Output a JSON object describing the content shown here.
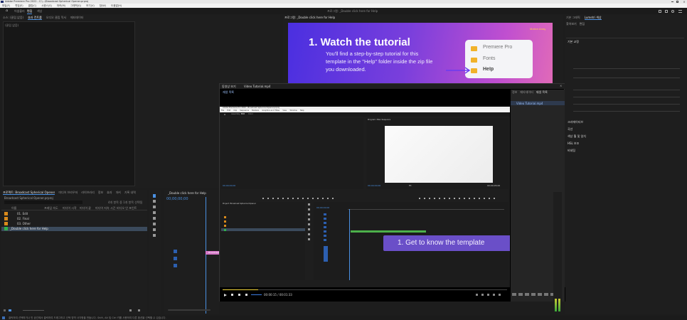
{
  "app": {
    "title_bar": "Adobe Premiere Pro 2022 - C:\\...\\Broadcast Spherical Opener.prproj",
    "menu": [
      "파일(F)",
      "편집(E)",
      "클립(C)",
      "시퀀스(S)",
      "마커(M)",
      "그래픽(G)",
      "보기(V)",
      "창(W)",
      "도움말(H)"
    ],
    "workspace_tabs": [
      "어셈블리",
      "편집",
      "색상"
    ],
    "active_workspace": "편집"
  },
  "source_panel": {
    "tabs": [
      "소스: (클립 없음)",
      "효과 컨트롤",
      "오디오 클립 믹서",
      "메타데이터"
    ],
    "empty_text": "(클립 없음)"
  },
  "program_panel": {
    "tab": "프로그램: _Double click here for Help"
  },
  "tutorial": {
    "brand": "Motion Array",
    "heading": "1.  Watch the tutorial",
    "body_line1": "You'll find a step-by-step tutorial for this",
    "body_line2": "template in the \"Help\" folder inside the zip file",
    "body_line3": "you downloaded.",
    "folders": [
      "Premiere Pro",
      "Fonts",
      "Help"
    ],
    "highlight_folder": "Help",
    "accent": "#6a3cf0"
  },
  "right_panel": {
    "tabs": [
      "기본 그래픽",
      "Lumetri 색상"
    ],
    "sub_tabs": [
      "찾아보기",
      "편집"
    ],
    "rows": [
      "기본 교정",
      "크리에이티브",
      "곡선",
      "색상 휠 및 일치",
      "HSL 보조",
      "비네팅"
    ]
  },
  "project_panel": {
    "tabs": [
      "프로젝트: Broadcast Spherical Opener",
      "미디어 브라우저",
      "라이브러리",
      "정보",
      "효과",
      "마커",
      "기록 내역"
    ],
    "file": "Broadcast Spherical Opener.prproj",
    "columns": [
      "이름",
      "프레임 속도",
      "미디어 시작",
      "미디어 끝",
      "미디어 지속 시간",
      "비디오 인 포인트"
    ],
    "items": [
      {
        "name": "01. Edit",
        "color": "#d98a1b"
      },
      {
        "name": "02. Final",
        "color": "#d98a1b"
      },
      {
        "name": "03. Other",
        "color": "#d98a1b"
      },
      {
        "name": "_Double click here for Help",
        "color": "#30b34a"
      }
    ],
    "item_count": "4개 항목 중 1개 항목 선택됨"
  },
  "timeline": {
    "tab": "_Double click here for Help",
    "timecode": "00;00;00;00",
    "clip_label": "Broadcast"
  },
  "video_player": {
    "tab": "동영상 보기",
    "title": "Video Tutorial.mp4",
    "subtitle": "재생 목록",
    "time": "00:00:15 / 00:01:33",
    "inner_title": "Adobe Premiere Pro 2022 - Broadcast Spherical Opener.prproj",
    "inner_menu": [
      "File",
      "Edit",
      "Clip",
      "Sequence",
      "Markers",
      "Graphics and Titles",
      "View",
      "Window",
      "Help"
    ],
    "inner_tabs": [
      "Assembly",
      "Edit",
      "Color"
    ],
    "inner_program": "Program: Main Sequence",
    "inner_tc_left": "00;00;00;00",
    "inner_tc_right": "00;00;05;00",
    "inner_fit": "Fit",
    "inner_project": "Project: Broadcast Spherical Opener",
    "caption": "1. Get to know the template",
    "right_tabs": [
      "정보",
      "메타데이터",
      "재생 목록"
    ],
    "right_item": "Video Tutorial.mp4"
  },
  "status_bar": {
    "text": "클릭하여 선택하거나 빈 공간에서 클릭하여 드래그하고 선택 영역 사각형을 만듭니다. Shift, Alt 및 Ctrl 키를 사용하여 다른 옵션을 선택할 수 있습니다."
  }
}
